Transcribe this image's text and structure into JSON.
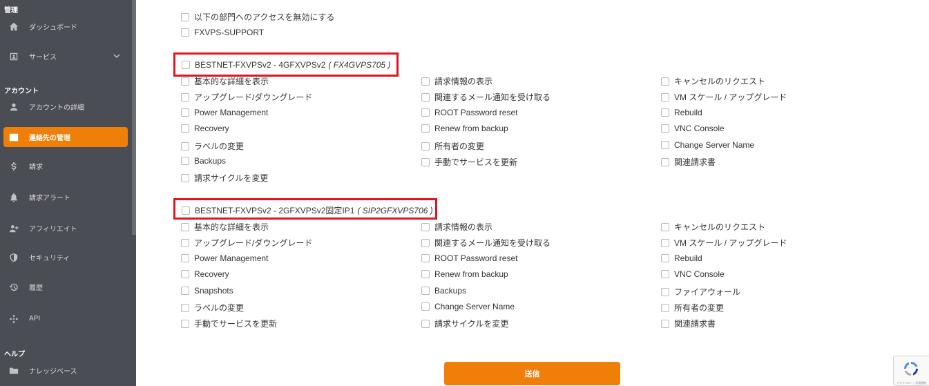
{
  "sidebar": {
    "sections": [
      {
        "key": "management",
        "heading": "管理",
        "items": [
          {
            "label": "ダッシュボード",
            "icon": "home-icon"
          },
          {
            "label": "サービス",
            "icon": "id-card-icon",
            "has_chevron": true
          }
        ]
      },
      {
        "key": "account",
        "heading": "アカウント",
        "items": [
          {
            "label": "アカウントの詳細",
            "icon": "user-icon"
          },
          {
            "label": "連絡先の管理",
            "icon": "contacts-icon",
            "active": true
          },
          {
            "label": "請求",
            "icon": "dollar-icon"
          },
          {
            "label": "請求アラート",
            "icon": "bell-icon"
          },
          {
            "label": "アフィリエイト",
            "icon": "users-plus-icon"
          },
          {
            "label": "セキュリティ",
            "icon": "shield-icon"
          },
          {
            "label": "履歴",
            "icon": "history-icon"
          },
          {
            "label": "API",
            "icon": "api-icon"
          }
        ]
      },
      {
        "key": "help",
        "heading": "ヘルプ",
        "items": [
          {
            "label": "ナレッジベース",
            "icon": "folder-icon"
          }
        ]
      }
    ]
  },
  "top_options": {
    "disable_access": "以下の部門へのアクセスを無効にする",
    "department": "FXVPS-SUPPORT"
  },
  "services": [
    {
      "name": "BESTNET-FXVPSv2 - 4GFXVPSv2",
      "code": "( FX4GVPS705 )",
      "columns": [
        [
          "基本的な詳細を表示",
          "アップグレード/ダウングレード",
          "Power Management",
          "Recovery",
          "ラベルの変更",
          "Backups",
          "請求サイクルを変更"
        ],
        [
          "請求情報の表示",
          "関連するメール通知を受け取る",
          "ROOT Password reset",
          "Renew from backup",
          "所有者の変更",
          "手動でサービスを更新"
        ],
        [
          "キャンセルのリクエスト",
          "VM スケール / アップグレード",
          "Rebuild",
          "VNC Console",
          "Change Server Name",
          "関連請求書"
        ]
      ]
    },
    {
      "name": "BESTNET-FXVPSv2 - 2GFXVPSv2固定IP1",
      "code": "( SIP2GFXVPS706 )",
      "columns": [
        [
          "基本的な詳細を表示",
          "アップグレード/ダウングレード",
          "Power Management",
          "Recovery",
          "Snapshots",
          "ラベルの変更",
          "手動でサービスを更新"
        ],
        [
          "請求情報の表示",
          "関連するメール通知を受け取る",
          "ROOT Password reset",
          "Renew from backup",
          "Backups",
          "Change Server Name",
          "請求サイクルを変更"
        ],
        [
          "キャンセルのリクエスト",
          "VM スケール / アップグレード",
          "Rebuild",
          "VNC Console",
          "ファイアウォール",
          "所有者の変更",
          "関連請求書"
        ]
      ]
    }
  ],
  "submit_label": "送信",
  "recaptcha_text": "プライバシー - 利用規約",
  "colors": {
    "accent": "#f07f0a",
    "sidebar_bg": "#4b4d54",
    "highlight_border": "#e0141e"
  }
}
